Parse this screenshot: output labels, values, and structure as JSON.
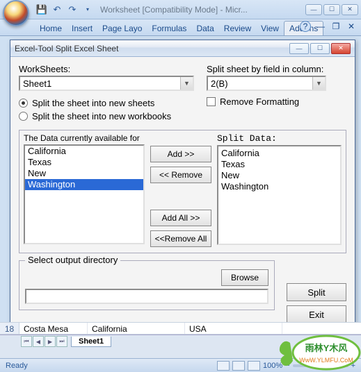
{
  "titlebar": {
    "title": "Worksheet  [Compatibility Mode] - Micr..."
  },
  "ribbon": {
    "tabs": [
      "Home",
      "Insert",
      "Page Layo",
      "Formulas",
      "Data",
      "Review",
      "View",
      "Add-Ins"
    ],
    "active": "Add-Ins"
  },
  "dialog": {
    "title": "Excel-Tool Split Excel Sheet",
    "worksheets_label": "WorkSheets:",
    "worksheets_value": "Sheet1",
    "splitcol_label": "Split sheet by field in column:",
    "splitcol_value": "2(B)",
    "radio1": "Split the sheet into new sheets",
    "radio2": "Split the sheet into new workbooks",
    "remove_fmt": "Remove Formatting",
    "available_label": "The Data currently available for",
    "split_data_label": "Split Data:",
    "available": [
      "California",
      "Texas",
      "New",
      "Washington"
    ],
    "selected_index": 3,
    "split_data": [
      "California",
      "Texas",
      "New",
      "Washington"
    ],
    "btn_add": "Add >>",
    "btn_remove": "<< Remove",
    "btn_addall": "Add All >>",
    "btn_removeall": "<<Remove All",
    "output_legend": "Select output directory",
    "browse": "Browse",
    "split": "Split",
    "exit": "Exit"
  },
  "grid": {
    "rownum": "18",
    "cells": [
      "Costa Mesa",
      "California",
      "USA"
    ]
  },
  "sheet_tabs": [
    "Sheet1"
  ],
  "status": {
    "ready": "Ready",
    "zoom": "100%"
  },
  "watermark": {
    "line1": "雨林Y木风",
    "line2": "WwW.YLMFU.CoM"
  }
}
